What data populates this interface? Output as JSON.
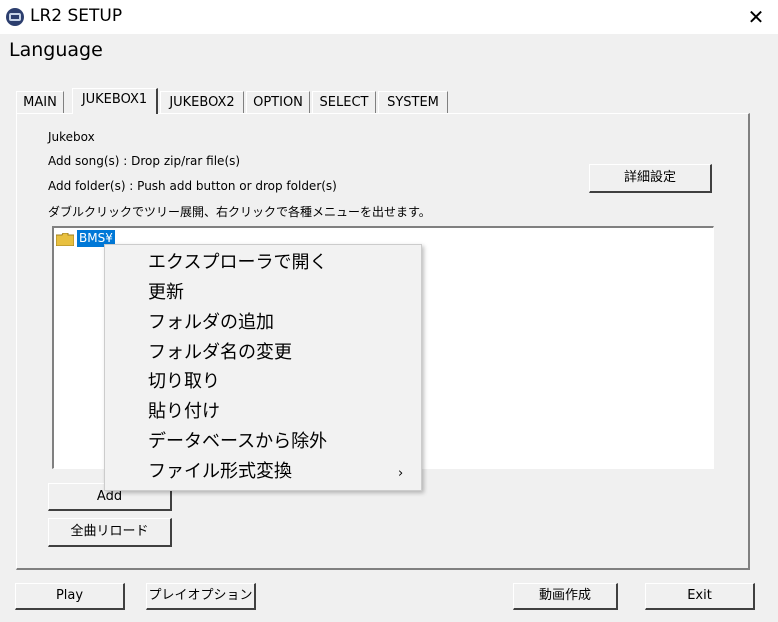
{
  "window": {
    "title": "LR2 SETUP",
    "close": "✕",
    "heading": "Language"
  },
  "tabs": [
    {
      "label": "MAIN",
      "active": false
    },
    {
      "label": "JUKEBOX1",
      "active": true
    },
    {
      "label": "JUKEBOX2",
      "active": false
    },
    {
      "label": "OPTION",
      "active": false
    },
    {
      "label": "SELECT",
      "active": false
    },
    {
      "label": "SYSTEM",
      "active": false
    }
  ],
  "jukebox": {
    "title": "Jukebox",
    "add_song": "Add song(s) : Drop zip/rar file(s)",
    "add_folder": "Add folder(s) : Push add button or drop folder(s)",
    "hint": "ダブルクリックでツリー展開、右クリックで各種メニューを出せます。",
    "details_button": "詳細設定",
    "tree_item": "BMS¥",
    "add_button": "Add",
    "reload_button": "全曲リロード"
  },
  "context_menu": [
    "エクスプローラで開く",
    "更新",
    "フォルダの追加",
    "フォルダ名の変更",
    "切り取り",
    "貼り付け",
    "データベースから除外",
    "ファイル形式変換"
  ],
  "submenu_arrow": "›",
  "footer": {
    "play": "Play",
    "play_option": "プレイオプション",
    "make_video": "動画作成",
    "exit": "Exit"
  }
}
